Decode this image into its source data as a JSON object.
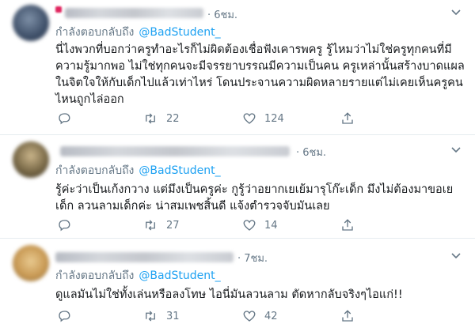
{
  "tweets": [
    {
      "time": "· 6ชม.",
      "reply_prefix": "กำลังตอบกลับถึง",
      "reply_handle": "@BadStudent_",
      "text": "นี่ไงพวกที่บอกว่าครูทำอะไรก็ไม่ผิดต้องเชื่อฟังเคารพครู รู้ไหมว่าไม่ใช่ครูทุกคนที่มีความรู้มากพอ ไม่ใช่ทุกคนจะมีจรรยาบรรณมีความเป็นคน ครูเหล่านั้นสร้างบาดแผลในจิตใจให้กับเด็กไปแล้วเท่าไหร่ โดนประจานความผิดหลายรายแต่ไม่เคยเห็นครูคนไหนถูกไล่ออก",
      "retweets": "22",
      "likes": "124"
    },
    {
      "time": "· 6ชม.",
      "reply_prefix": "กำลังตอบกลับถึง",
      "reply_handle": "@BadStudent_",
      "text": "รู้ค่ะว่าเป็นเก้งกวาง แต่มึงเป็นครูค่ะ กูรู้ว่าอยากเยเย้มารุโก๊ะเด็ก มึงไม่ต้องมาขอเยเด็ก ลวนลามเด็กค่ะ น่าสมเพชสิ้นดี แจ้งตำรวจจับมันเลย",
      "retweets": "27",
      "likes": "14"
    },
    {
      "time": "· 7ชม.",
      "reply_prefix": "กำลังตอบกลับถึง",
      "reply_handle": "@BadStudent_",
      "text": "ดูแลมันไม่ใช่ทั้งเล่นหรือลงโทษ ไอนี่มันลวนลาม ตัดหากลับจริงๆไอแก่!!",
      "retweets": "31",
      "likes": "42"
    }
  ],
  "icons": {
    "reply": "reply-icon",
    "retweet": "retweet-icon",
    "like": "heart-icon",
    "share": "share-icon",
    "more": "chevron-down-icon"
  },
  "colors": {
    "link": "#1da1f2",
    "muted": "#657786",
    "text": "#14171a"
  }
}
